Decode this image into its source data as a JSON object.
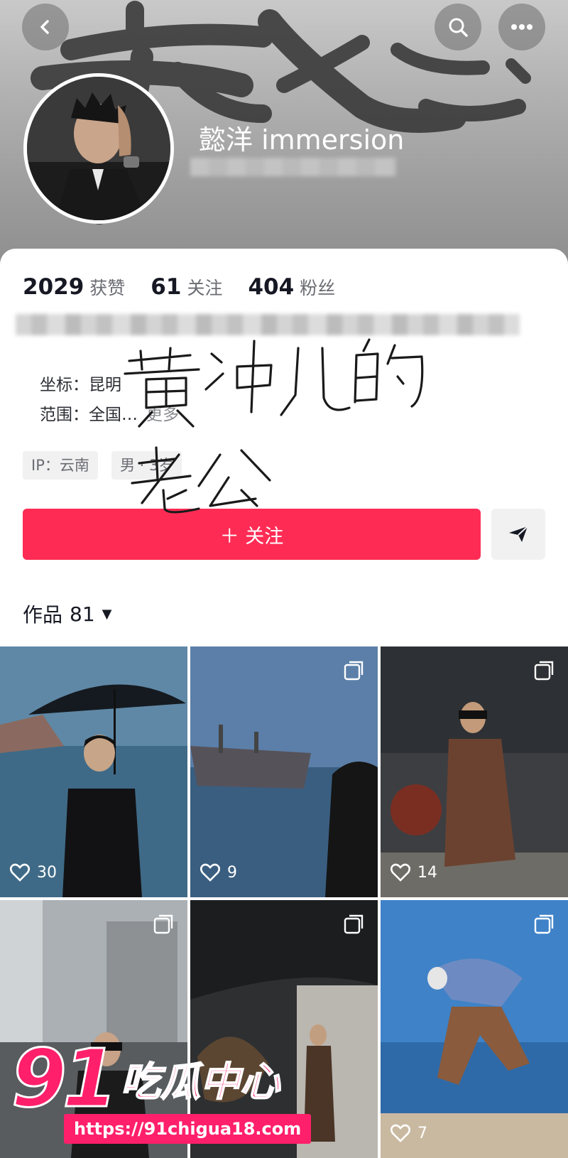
{
  "profile": {
    "nickname": "懿洋 immersion"
  },
  "stats": [
    {
      "value": "2029",
      "label": "获赞"
    },
    {
      "value": "61",
      "label": "关注"
    },
    {
      "value": "404",
      "label": "粉丝"
    }
  ],
  "info": {
    "location_label": "坐标：",
    "location_value": "昆明",
    "range_label": "范围：",
    "range_value": "全国…",
    "more": "更多"
  },
  "tags": {
    "ip": "IP：云南",
    "gender_age": "男 · 3",
    "age_suffix": "岁"
  },
  "buttons": {
    "follow": "＋ 关注"
  },
  "works": {
    "label": "作品",
    "count": "81"
  },
  "annotation": {
    "line1": "黄冲儿的",
    "line2": "老公"
  },
  "grid": [
    {
      "likes": "30",
      "multi": false
    },
    {
      "likes": "9",
      "multi": true
    },
    {
      "likes": "14",
      "multi": true
    },
    {
      "likes": "",
      "multi": true
    },
    {
      "likes": "",
      "multi": true
    },
    {
      "likes": "7",
      "multi": true
    }
  ],
  "watermark": {
    "logo": "91",
    "title": "吃瓜中心",
    "url": "https://91chigua18.com"
  },
  "colors": {
    "accent": "#fe2c55",
    "watermark": "#ff1f6b"
  },
  "icons": [
    "back-icon",
    "search-icon",
    "more-icon",
    "share-icon",
    "heart-icon",
    "multi-image-icon"
  ]
}
